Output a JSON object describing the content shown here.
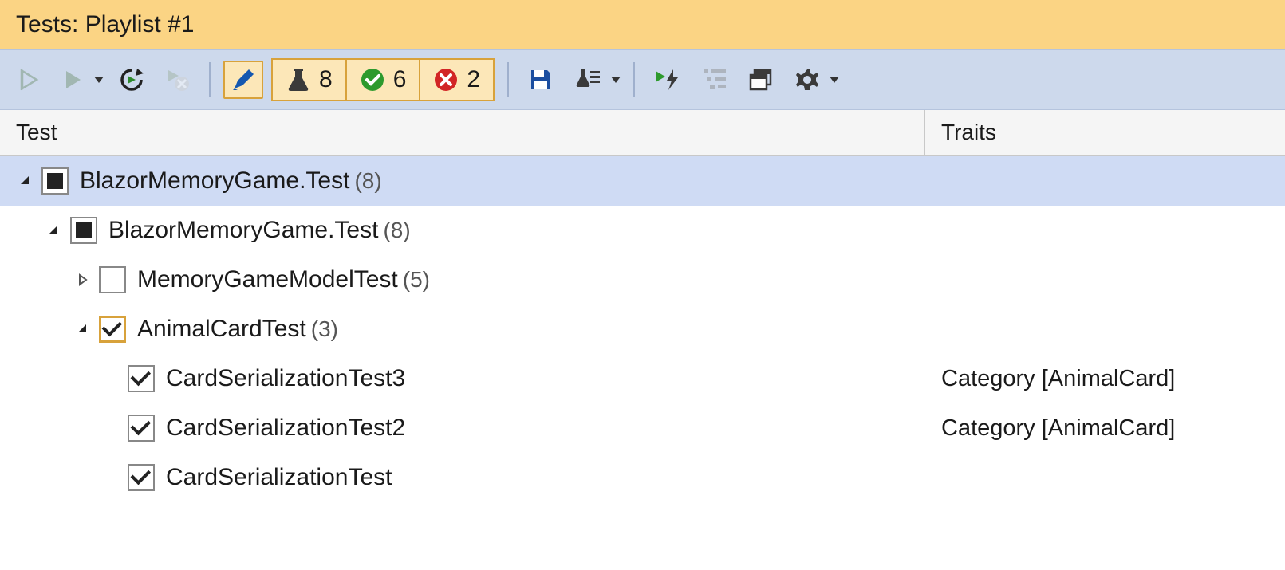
{
  "title": "Tests: Playlist #1",
  "counts": {
    "total": "8",
    "passed": "6",
    "failed": "2"
  },
  "columns": {
    "test": "Test",
    "traits": "Traits"
  },
  "rows": [
    {
      "indent": 0,
      "expander": "expanded-filled",
      "check": "square",
      "name": "BlazorMemoryGame.Test",
      "count": "(8)",
      "traits": "",
      "selected": true
    },
    {
      "indent": 1,
      "expander": "expanded-filled",
      "check": "square",
      "name": "BlazorMemoryGame.Test",
      "count": "(8)",
      "traits": ""
    },
    {
      "indent": 2,
      "expander": "collapsed",
      "check": "empty",
      "name": "MemoryGameModelTest",
      "count": "(5)",
      "traits": ""
    },
    {
      "indent": 2,
      "expander": "expanded-filled",
      "check": "checked-selected",
      "name": "AnimalCardTest",
      "count": "(3)",
      "traits": ""
    },
    {
      "indent": 3,
      "expander": "none",
      "check": "checked",
      "name": "CardSerializationTest3",
      "count": "",
      "traits": "Category [AnimalCard]"
    },
    {
      "indent": 3,
      "expander": "none",
      "check": "checked",
      "name": "CardSerializationTest2",
      "count": "",
      "traits": "Category [AnimalCard]"
    },
    {
      "indent": 3,
      "expander": "none",
      "check": "checked",
      "name": "CardSerializationTest",
      "count": "",
      "traits": ""
    }
  ]
}
